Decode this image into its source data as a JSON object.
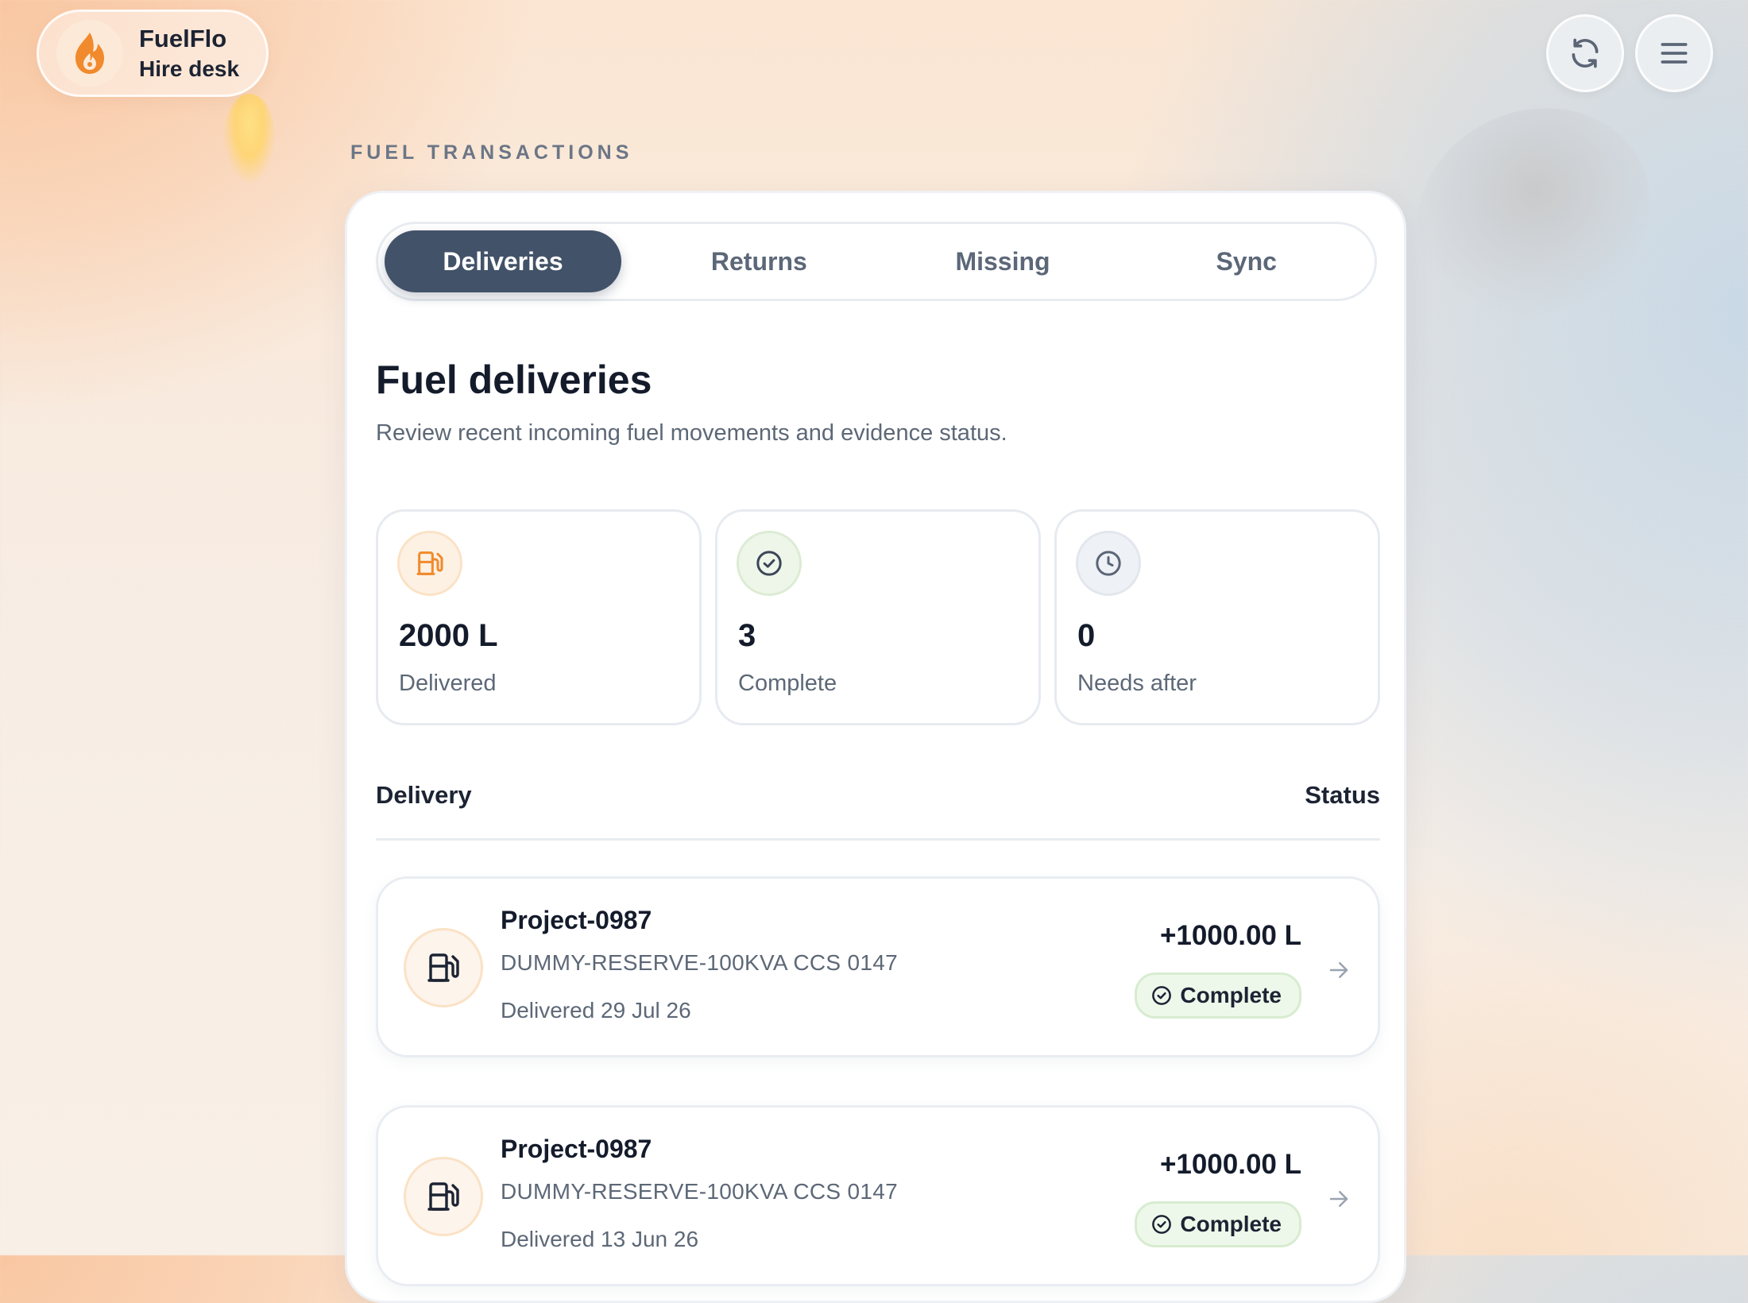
{
  "brand": {
    "name": "FuelFlo",
    "subtitle": "Hire desk"
  },
  "section_label": "FUEL TRANSACTIONS",
  "tabs": [
    {
      "label": "Deliveries",
      "active": true
    },
    {
      "label": "Returns",
      "active": false
    },
    {
      "label": "Missing",
      "active": false
    },
    {
      "label": "Sync",
      "active": false
    }
  ],
  "page": {
    "title": "Fuel deliveries",
    "subtitle": "Review recent incoming fuel movements and evidence status."
  },
  "stats": [
    {
      "value": "2000 L",
      "label": "Delivered",
      "icon": "fuel-pump-icon"
    },
    {
      "value": "3",
      "label": "Complete",
      "icon": "check-circle-icon"
    },
    {
      "value": "0",
      "label": "Needs after",
      "icon": "clock-icon"
    }
  ],
  "list_header": {
    "left": "Delivery",
    "right": "Status"
  },
  "deliveries": [
    {
      "project": "Project-0987",
      "asset": "DUMMY-RESERVE-100KVA CCS 0147",
      "date": "Delivered 29 Jul 26",
      "amount": "+1000.00 L",
      "status": "Complete"
    },
    {
      "project": "Project-0987",
      "asset": "DUMMY-RESERVE-100KVA CCS 0147",
      "date": "Delivered 13 Jun 26",
      "amount": "+1000.00 L",
      "status": "Complete"
    }
  ],
  "colors": {
    "accent_orange": "#f08a2c",
    "active_tab": "#425268",
    "success_green": "#eef8ea"
  }
}
